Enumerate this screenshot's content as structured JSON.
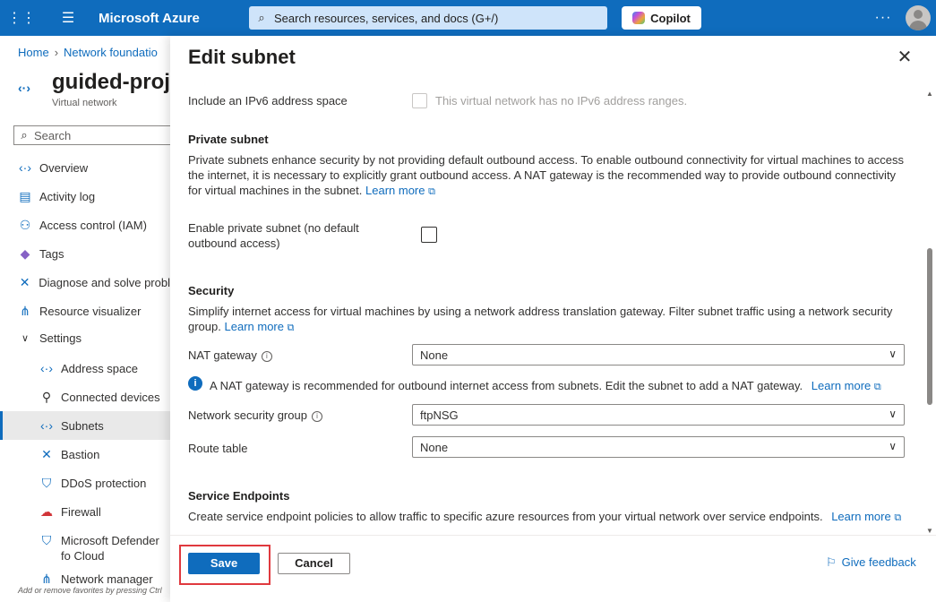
{
  "topbar": {
    "brand": "Microsoft Azure",
    "search_placeholder": "Search resources, services, and docs (G+/)",
    "copilot_label": "Copilot",
    "more": "···",
    "accent_color": "#0f6cbd"
  },
  "left": {
    "breadcrumb": [
      "Home",
      "Network foundatio"
    ],
    "resource_title": "guided-proj",
    "resource_subtitle": "Virtual network",
    "search_placeholder": "Search",
    "nav": [
      {
        "label": "Overview",
        "icon": "vnet-icon"
      },
      {
        "label": "Activity log",
        "icon": "log-icon"
      },
      {
        "label": "Access control (IAM)",
        "icon": "people-icon"
      },
      {
        "label": "Tags",
        "icon": "tag-icon"
      },
      {
        "label": "Diagnose and solve probl",
        "icon": "wrench-icon"
      },
      {
        "label": "Resource visualizer",
        "icon": "hierarchy-icon"
      },
      {
        "label": "Settings",
        "icon": "chevron-down-icon"
      },
      {
        "label": "Address space",
        "icon": "vnet-icon"
      },
      {
        "label": "Connected devices",
        "icon": "plug-icon"
      },
      {
        "label": "Subnets",
        "icon": "vnet-icon"
      },
      {
        "label": "Bastion",
        "icon": "bastion-icon"
      },
      {
        "label": "DDoS protection",
        "icon": "shield-icon"
      },
      {
        "label": "Firewall",
        "icon": "firewall-icon"
      },
      {
        "label": "Microsoft Defender fo Cloud",
        "icon": "defender-icon"
      },
      {
        "label": "Network manager",
        "icon": "network-icon"
      }
    ],
    "hint": "Add or remove favorites by pressing Ctrl"
  },
  "panel": {
    "title": "Edit subnet",
    "ipv6_label": "Include an IPv6 address space",
    "ipv6_note": "This virtual network has no IPv6 address ranges.",
    "private_heading": "Private subnet",
    "private_desc": "Private subnets enhance security by not providing default outbound access. To enable outbound connectivity for virtual machines to access the internet, it is necessary to explicitly grant outbound access. A NAT gateway is the recommended way to provide outbound connectivity for virtual machines in the subnet.",
    "learn_more": "Learn more",
    "private_enable_label": "Enable private subnet (no default outbound access)",
    "security_heading": "Security",
    "security_desc": "Simplify internet access for virtual machines by using a network address translation gateway. Filter subnet traffic using a network security group.",
    "nat_label": "NAT gateway",
    "nat_value": "None",
    "nat_info": "A NAT gateway is recommended for outbound internet access from subnets. Edit the subnet to add a NAT gateway.",
    "nsg_label": "Network security group",
    "nsg_value": "ftpNSG",
    "route_label": "Route table",
    "route_value": "None",
    "endpoints_heading": "Service Endpoints",
    "endpoints_desc": "Create service endpoint policies to allow traffic to specific azure resources from your virtual network over service endpoints."
  },
  "footer": {
    "save": "Save",
    "cancel": "Cancel",
    "feedback": "Give feedback",
    "highlight_color": "#e0393e"
  }
}
